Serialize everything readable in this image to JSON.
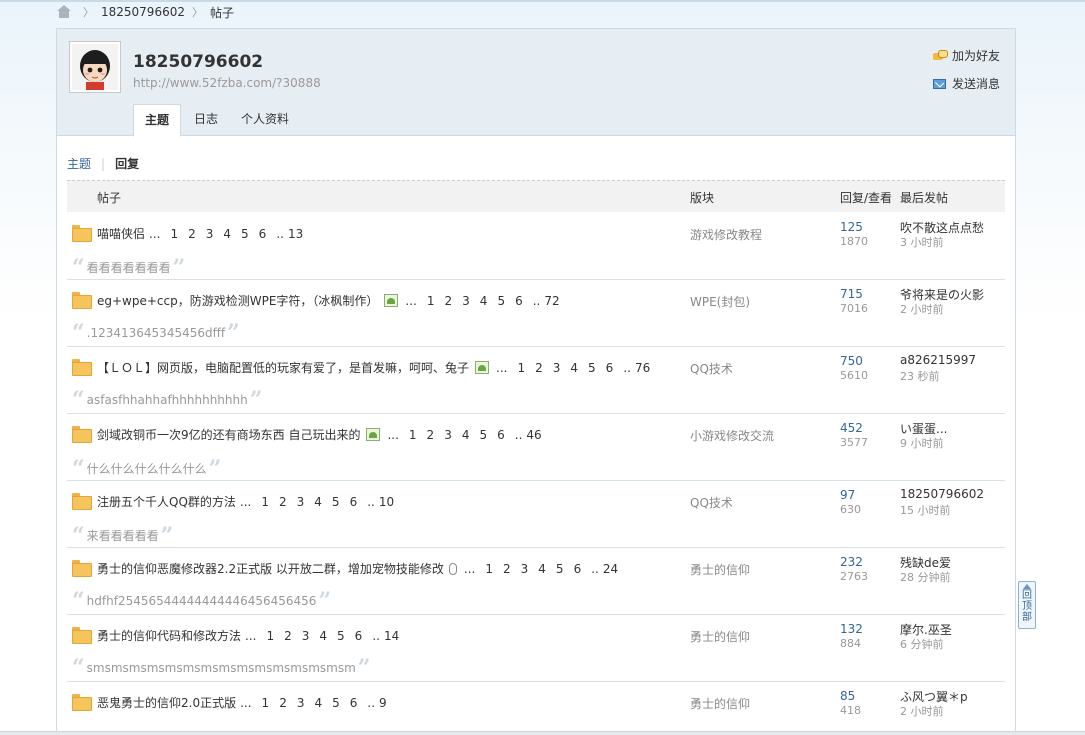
{
  "breadcrumb": {
    "items": [
      "18250796602",
      "帖子"
    ]
  },
  "profile": {
    "name": "18250796602",
    "url": "http://www.52fzba.com/?30888",
    "actions": {
      "add_friend": "加为好友",
      "send_message": "发送消息"
    },
    "tabs": [
      "主题",
      "日志",
      "个人资料"
    ]
  },
  "subnav": {
    "topics": "主题",
    "replies": "回复"
  },
  "table": {
    "headers": {
      "post": "帖子",
      "forum": "版块",
      "stats": "回复/查看",
      "last": "最后发帖"
    },
    "rows": [
      {
        "title": "喵喵侠侣",
        "has_image": false,
        "has_attach": false,
        "pages": [
          "1",
          "2",
          "3",
          "4",
          "5",
          "6",
          "..",
          "13"
        ],
        "forum": "游戏修改教程",
        "replies": "125",
        "views": "1870",
        "last_user": "吹不散这点点愁",
        "last_time": "3 小时前",
        "quote": "看看看看看看看"
      },
      {
        "title": "eg+wpe+ccp，防游戏检测WPE字符，（冰枫制作）",
        "has_image": true,
        "has_attach": false,
        "pages": [
          "1",
          "2",
          "3",
          "4",
          "5",
          "6",
          "..",
          "72"
        ],
        "forum": "WPE(封包)",
        "replies": "715",
        "views": "7016",
        "last_user": "爷将来是の火影",
        "last_time": "2 小时前",
        "quote": ".123413645345456dfff"
      },
      {
        "title": "【ＬＯＬ】网页版，电脑配置低的玩家有爱了，是首发嘛，呵呵、兔子",
        "has_image": true,
        "has_attach": false,
        "pages": [
          "1",
          "2",
          "3",
          "4",
          "5",
          "6",
          "..",
          "76"
        ],
        "forum": "QQ技术",
        "replies": "750",
        "views": "5610",
        "last_user": "a826215997",
        "last_time": "23 秒前",
        "quote": "asfasfhhahhafhhhhhhhhhh"
      },
      {
        "title": "剑域改铜币一次9亿的还有商场东西 自己玩出来的",
        "has_image": true,
        "has_attach": false,
        "pages": [
          "1",
          "2",
          "3",
          "4",
          "5",
          "6",
          "..",
          "46"
        ],
        "forum": "小游戏修改交流",
        "replies": "452",
        "views": "3577",
        "last_user": "い蛋蛋...",
        "last_time": "9 小时前",
        "quote": "什么什么什么什么什么"
      },
      {
        "title": "注册五个千人QQ群的方法",
        "has_image": false,
        "has_attach": false,
        "pages": [
          "1",
          "2",
          "3",
          "4",
          "5",
          "6",
          "..",
          "10"
        ],
        "forum": "QQ技术",
        "replies": "97",
        "views": "630",
        "last_user": "18250796602",
        "last_time": "15 小时前",
        "quote": "来看看看看看"
      },
      {
        "title": "勇士的信仰恶魔修改器2.2正式版 以开放二群，增加宠物技能修改",
        "has_image": false,
        "has_attach": true,
        "pages": [
          "1",
          "2",
          "3",
          "4",
          "5",
          "6",
          "..",
          "24"
        ],
        "forum": "勇士的信仰",
        "replies": "232",
        "views": "2763",
        "last_user": "残缺de爱",
        "last_time": "28 分钟前",
        "quote": "hdfhf25456544444444446456456456"
      },
      {
        "title": "勇士的信仰代码和修改方法",
        "has_image": false,
        "has_attach": false,
        "pages": [
          "1",
          "2",
          "3",
          "4",
          "5",
          "6",
          "..",
          "14"
        ],
        "forum": "勇士的信仰",
        "replies": "132",
        "views": "884",
        "last_user": "摩尔.巫圣",
        "last_time": "6 分钟前",
        "quote": "smsmsmsmsmsmsmsmsmsmsmsmsmsmsm"
      },
      {
        "title": "恶鬼勇士的信仰2.0正式版",
        "has_image": false,
        "has_attach": false,
        "pages": [
          "1",
          "2",
          "3",
          "4",
          "5",
          "6",
          "..",
          "9"
        ],
        "forum": "勇士的信仰",
        "replies": "85",
        "views": "418",
        "last_user": "ふ风つ翼＊p",
        "last_time": "2 小时前",
        "quote": ""
      }
    ]
  },
  "back_to_top": [
    "回",
    "顶",
    "部"
  ],
  "colors": {
    "link": "#336699",
    "header_bg": "#e6eef4",
    "border": "#cdd9e3"
  }
}
